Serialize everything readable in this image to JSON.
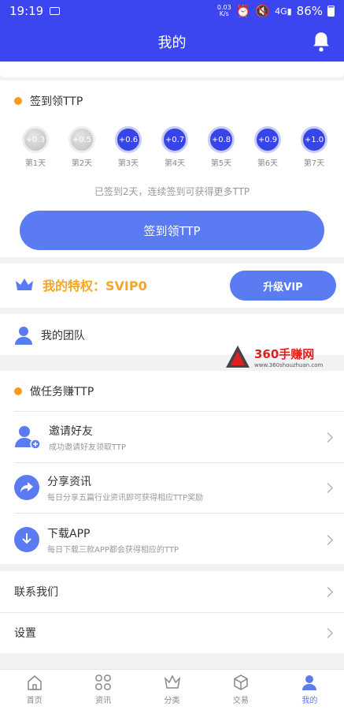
{
  "status_bar": {
    "time": "19:19",
    "net_speed_top": "0.03",
    "net_speed_bottom": "K/s",
    "battery": "86%"
  },
  "header": {
    "title": "我的"
  },
  "checkin": {
    "title": "签到领TTP",
    "days": [
      {
        "value": "+0.3",
        "label": "第1天",
        "done": true
      },
      {
        "value": "+0.5",
        "label": "第2天",
        "done": true
      },
      {
        "value": "+0.6",
        "label": "第3天",
        "done": false
      },
      {
        "value": "+0.7",
        "label": "第4天",
        "done": false
      },
      {
        "value": "+0.8",
        "label": "第5天",
        "done": false
      },
      {
        "value": "+0.9",
        "label": "第6天",
        "done": false
      },
      {
        "value": "+1.0",
        "label": "第7天",
        "done": false
      }
    ],
    "hint": "已签到2天，连续签到可获得更多TTP",
    "button": "签到领TTP"
  },
  "privilege": {
    "label": "我的特权：SVIP0",
    "upgrade_button": "升级VIP"
  },
  "team": {
    "label": "我的团队"
  },
  "watermark": {
    "brand": "360手赚网",
    "url": "www.360shouzhuan.com"
  },
  "tasks": {
    "title": "做任务赚TTP",
    "items": [
      {
        "title": "邀请好友",
        "subtitle": "成功邀请好友领取TTP"
      },
      {
        "title": "分享资讯",
        "subtitle": "每日分享五篇行业资讯即可获得相应TTP奖励"
      },
      {
        "title": "下载APP",
        "subtitle": "每日下载三款APP都会获得相应的TTP"
      }
    ]
  },
  "menu": {
    "contact": "联系我们",
    "settings": "设置"
  },
  "tabbar": {
    "items": [
      "首页",
      "资讯",
      "分类",
      "交易",
      "我的"
    ],
    "active_index": 4
  },
  "colors": {
    "primary": "#3b45f0",
    "accent_button": "#5b7bf3",
    "orange": "#ff9a1f",
    "vip_text": "#f5a623"
  }
}
